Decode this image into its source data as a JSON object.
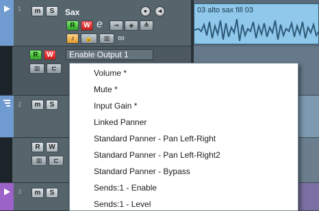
{
  "tracks": [
    {
      "number": "1",
      "name": "Sax",
      "mute_label": "m",
      "solo_label": "S",
      "read_label": "R",
      "write_label": "W",
      "edit_label": "e"
    },
    {
      "number": "2",
      "mute_label": "m",
      "solo_label": "S",
      "read_label": "R",
      "write_label": "W"
    },
    {
      "number": "3",
      "mute_label": "m",
      "solo_label": "S"
    }
  ],
  "automation_lane": {
    "read_label": "R",
    "write_label": "W",
    "parameter_value": "Enable Output 1"
  },
  "event": {
    "title": "03 alto sax fill 03"
  },
  "context_menu": {
    "items": [
      "Volume *",
      "Mute *",
      "Input Gain *",
      "Linked Panner",
      "Standard Panner - Pan Left-Right",
      "Standard Panner - Pan Left-Right2",
      "Standard Panner - Bypass",
      "Sends:1 - Enable",
      "Sends:1 - Level"
    ]
  },
  "colors": {
    "track_strip": "#6f9bd0",
    "track3_strip": "#9b63c8",
    "event_fill": "#8fc8ea",
    "menu_bg": "#ffffff"
  },
  "icons": {
    "record": "record-icon",
    "monitor": "monitor-icon",
    "lanes": "lanes-icon",
    "folder": "folder-icon",
    "link": "link-icon"
  }
}
